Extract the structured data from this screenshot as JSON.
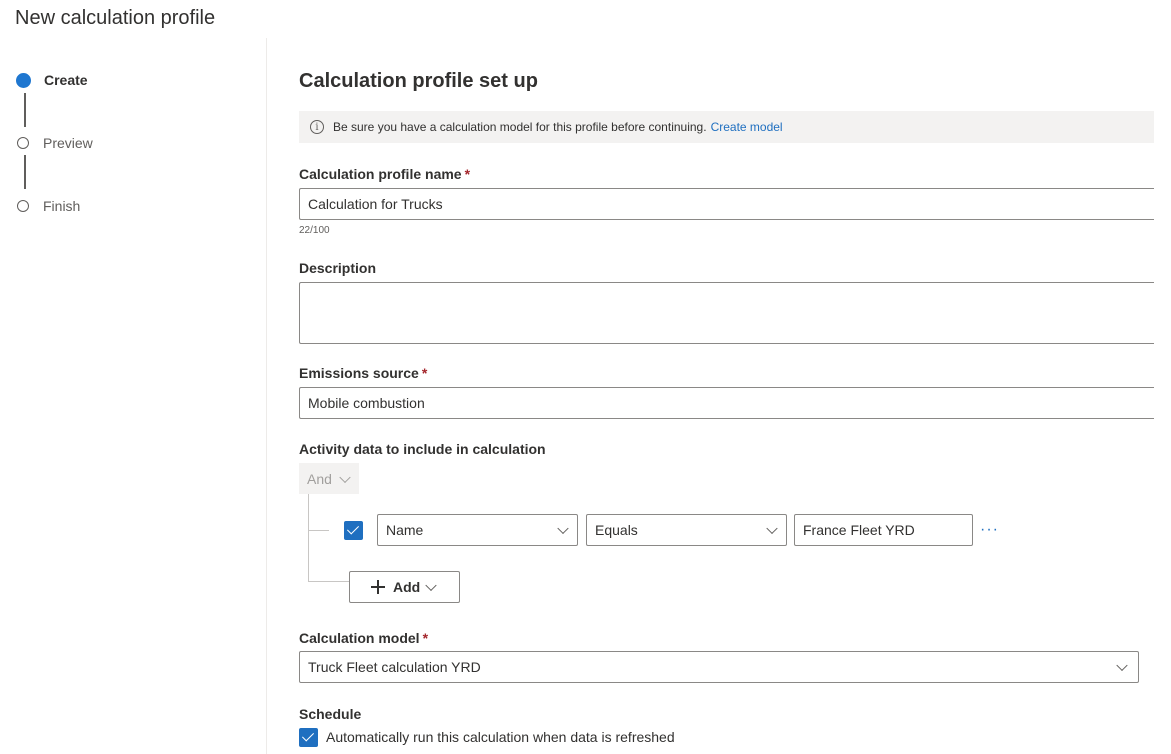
{
  "page": {
    "title": "New calculation profile"
  },
  "stepper": {
    "steps": [
      {
        "label": "Create",
        "active": true
      },
      {
        "label": "Preview",
        "active": false
      },
      {
        "label": "Finish",
        "active": false
      }
    ]
  },
  "form": {
    "title": "Calculation profile set up",
    "info": {
      "message": "Be sure you have a calculation model for this profile before continuing.",
      "link_label": "Create model"
    },
    "profile_name": {
      "label": "Calculation profile name",
      "required_mark": "*",
      "value": "Calculation for Trucks",
      "char_count": "22/100"
    },
    "description": {
      "label": "Description",
      "value": ""
    },
    "emissions_source": {
      "label": "Emissions source",
      "required_mark": "*",
      "value": "Mobile combustion"
    },
    "activity_data": {
      "label": "Activity data to include in calculation",
      "operator": "And",
      "condition": {
        "checked": true,
        "field": "Name",
        "comparison": "Equals",
        "value": "France Fleet YRD"
      },
      "more_label": "···",
      "add_label": "Add"
    },
    "calculation_model": {
      "label": "Calculation model",
      "required_mark": "*",
      "value": "Truck Fleet calculation YRD"
    },
    "schedule": {
      "label": "Schedule",
      "checked": true,
      "option_label": "Automatically run this calculation when data is refreshed"
    }
  },
  "colors": {
    "accent": "#1f6fc0",
    "required": "#a4262c",
    "info_bg": "#f3f2f1"
  }
}
